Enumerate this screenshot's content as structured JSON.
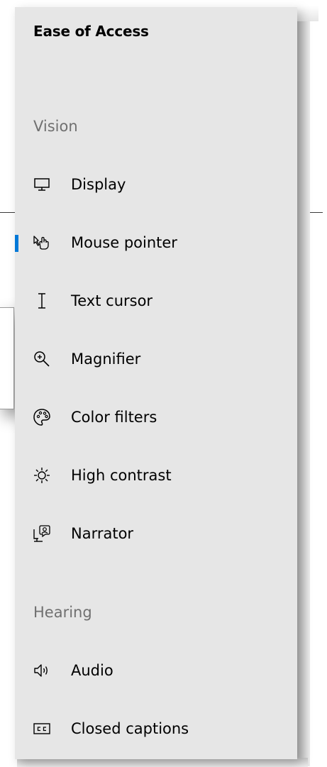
{
  "flyout": {
    "title": "Ease of Access",
    "sections": [
      {
        "header": "Vision",
        "items": [
          {
            "label": "Display",
            "icon": "monitor-icon",
            "selected": false
          },
          {
            "label": "Mouse pointer",
            "icon": "pointer-hand-icon",
            "selected": true
          },
          {
            "label": "Text cursor",
            "icon": "text-cursor-icon",
            "selected": false
          },
          {
            "label": "Magnifier",
            "icon": "magnifier-icon",
            "selected": false
          },
          {
            "label": "Color filters",
            "icon": "palette-icon",
            "selected": false
          },
          {
            "label": "High contrast",
            "icon": "brightness-icon",
            "selected": false
          },
          {
            "label": "Narrator",
            "icon": "narrator-icon",
            "selected": false
          }
        ]
      },
      {
        "header": "Hearing",
        "items": [
          {
            "label": "Audio",
            "icon": "speaker-icon",
            "selected": false
          },
          {
            "label": "Closed captions",
            "icon": "closed-captions-icon",
            "selected": false
          }
        ]
      }
    ]
  },
  "colors": {
    "panel_background": "#e6e6e6",
    "accent": "#0078d7",
    "section_header": "#707070"
  }
}
